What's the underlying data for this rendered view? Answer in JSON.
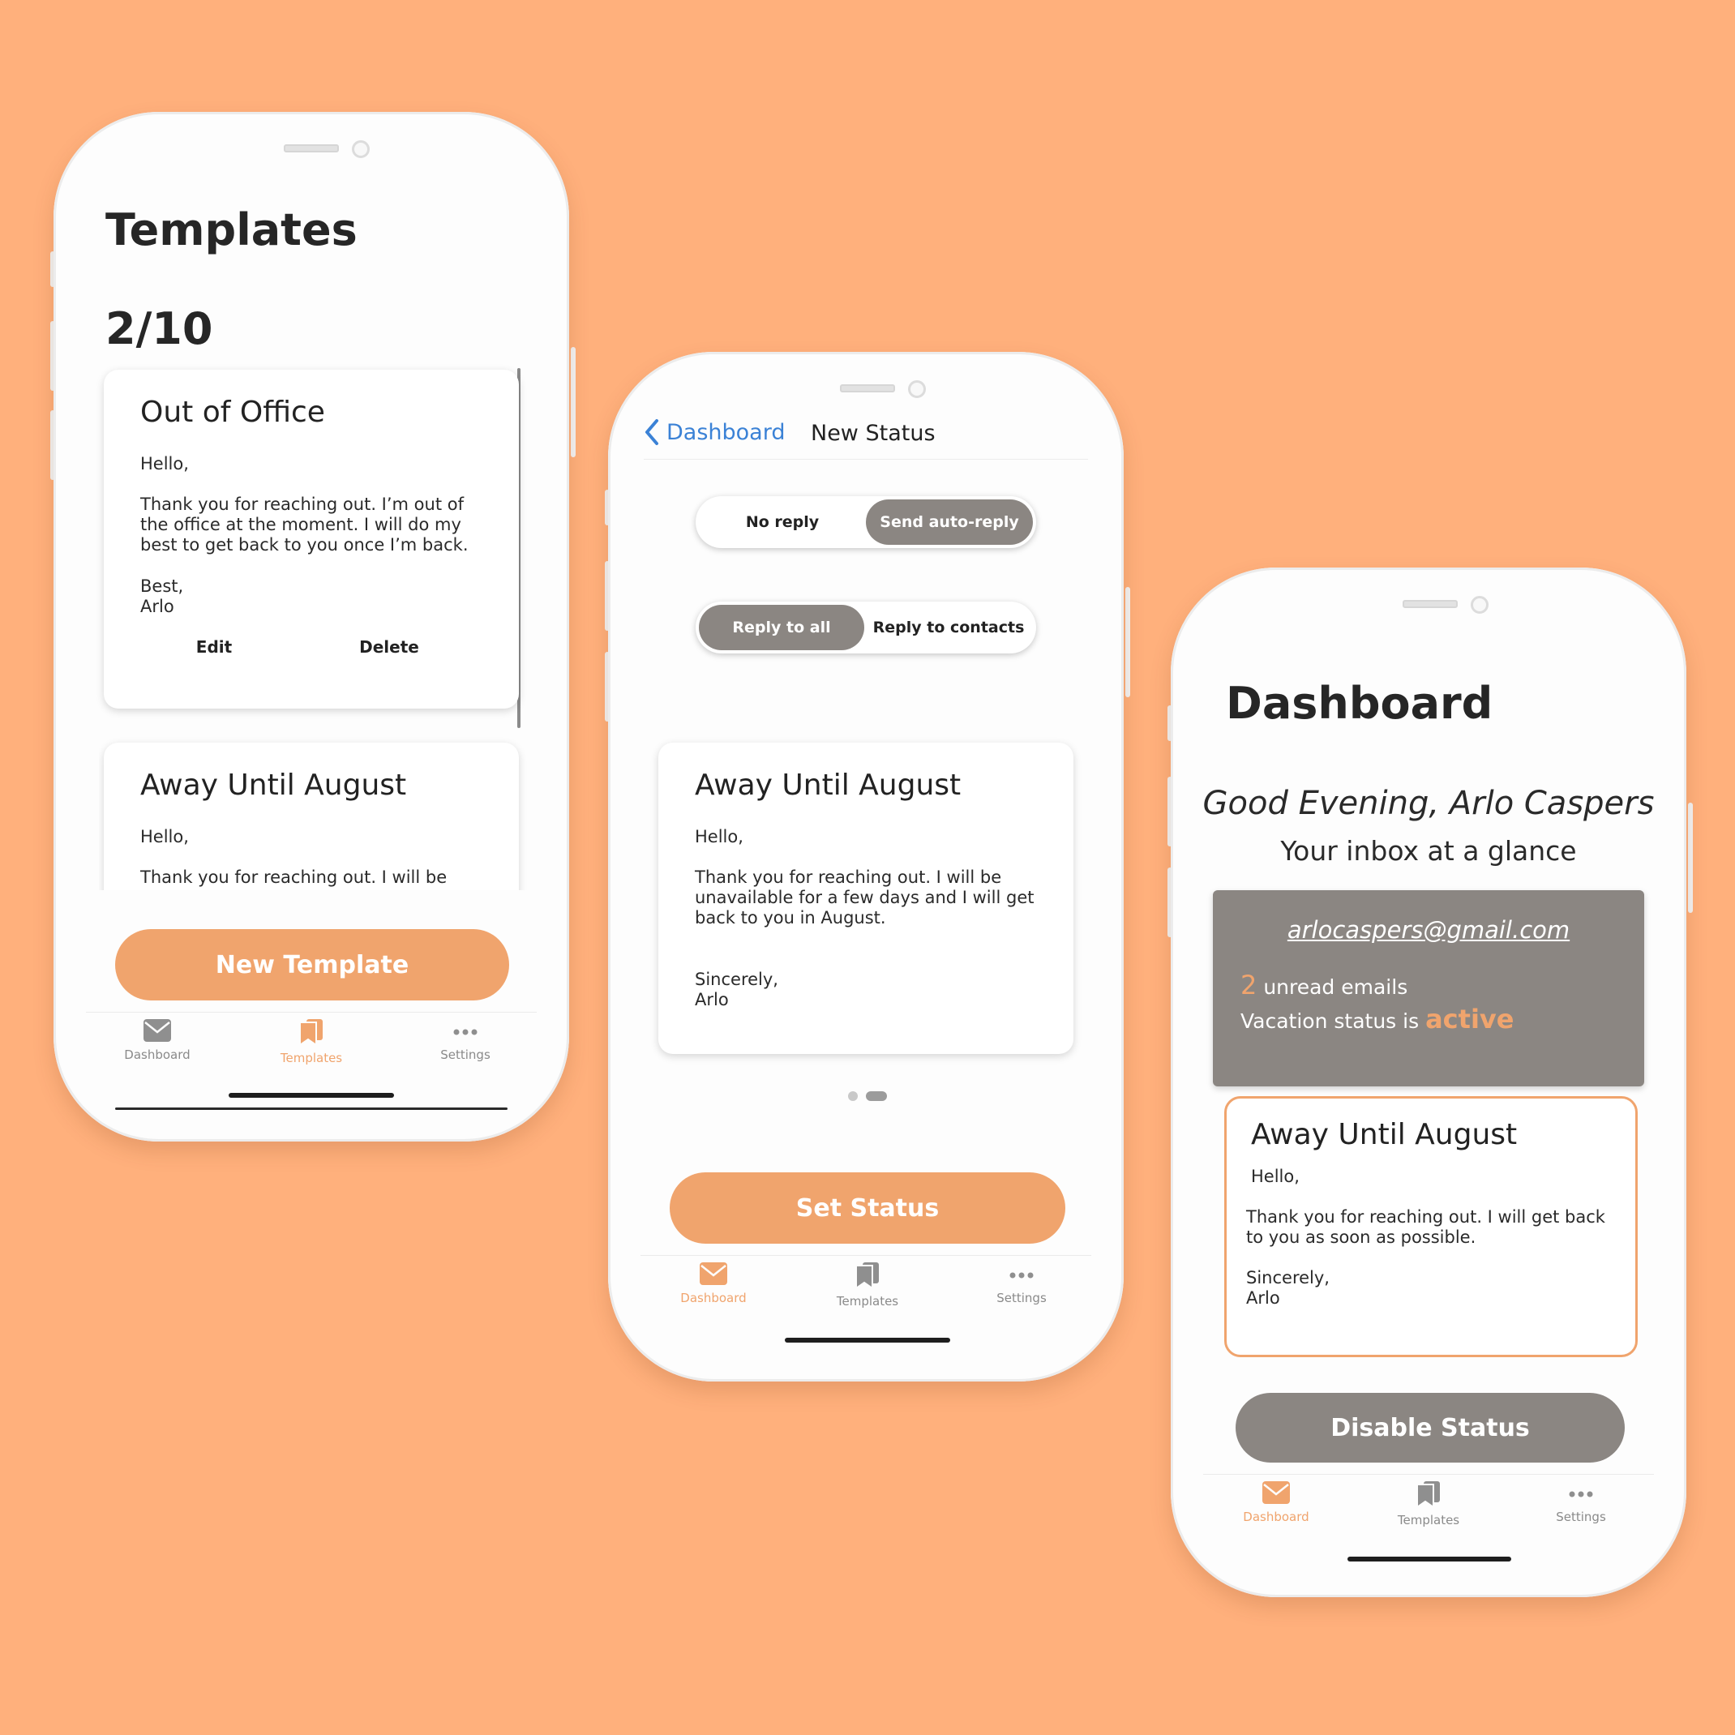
{
  "colors": {
    "background": "#ffb07c",
    "accent": "#f0a46d",
    "gray": "#8b8682"
  },
  "templates_screen": {
    "title": "Templates",
    "count": "2/10",
    "cards": [
      {
        "title": "Out of Office",
        "greeting": "Hello,",
        "body": "Thank you for reaching out. I’m out of the office at the moment. I will do my best to get back to you once I’m back.",
        "closing": "Best,",
        "signature": "Arlo",
        "edit_label": "Edit",
        "delete_label": "Delete"
      },
      {
        "title": "Away Until August",
        "greeting": "Hello,",
        "body": "Thank you for reaching out. I will be"
      }
    ],
    "new_template_label": "New Template"
  },
  "new_status_screen": {
    "back_label": "Dashboard",
    "title": "New Status",
    "reply_toggle": {
      "options": [
        "No reply",
        "Send auto-reply"
      ],
      "selected": "Send auto-reply"
    },
    "recipient_toggle": {
      "options": [
        "Reply to all",
        "Reply to contacts"
      ],
      "selected": "Reply to all"
    },
    "card": {
      "title": "Away Until August",
      "greeting": "Hello,",
      "body": "Thank you for reaching out. I will be unavailable for a few days and I will get back to you in August.",
      "closing": "Sincerely,",
      "signature": "Arlo"
    },
    "page_indicator": {
      "pages": 2,
      "current": 2
    },
    "set_status_label": "Set Status"
  },
  "dashboard_screen": {
    "title": "Dashboard",
    "greeting": "Good Evening, Arlo Caspers",
    "subtitle": "Your inbox at a glance",
    "email": "arlocaspers@gmail.com",
    "unread_count": "2",
    "unread_label": "unread emails",
    "vacation_label": "Vacation status is",
    "vacation_status": "active",
    "card": {
      "title": "Away Until August",
      "greeting": "Hello,",
      "body": "Thank you for reaching out. I will get back to you as soon as possible.",
      "closing": "Sincerely,",
      "signature": "Arlo"
    },
    "disable_label": "Disable Status"
  },
  "tabbar": {
    "dashboard": "Dashboard",
    "templates": "Templates",
    "settings": "Settings",
    "icons": [
      "envelope-icon",
      "bookmark-icon",
      "more-dots-icon"
    ]
  }
}
